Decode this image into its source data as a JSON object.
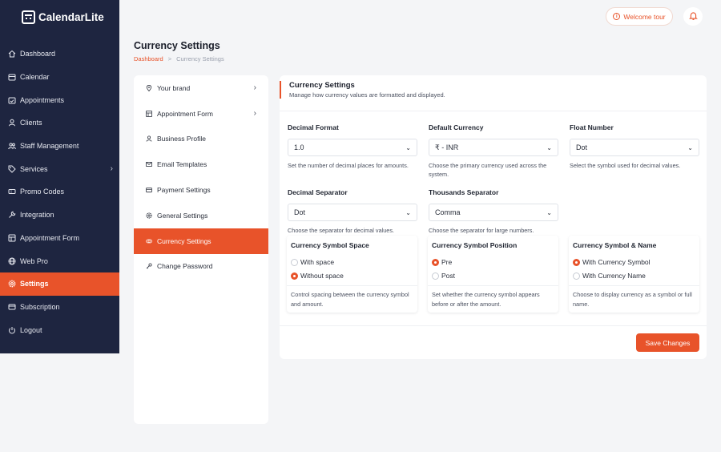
{
  "brand": {
    "name": "CalendarLite"
  },
  "topbar": {
    "welcome_label": "Welcome tour"
  },
  "sidebar": {
    "items": [
      {
        "label": "Dashboard",
        "icon": "home-icon"
      },
      {
        "label": "Calendar",
        "icon": "calendar-icon"
      },
      {
        "label": "Appointments",
        "icon": "calendar-check-icon"
      },
      {
        "label": "Clients",
        "icon": "user-icon"
      },
      {
        "label": "Staff Management",
        "icon": "users-icon"
      },
      {
        "label": "Services",
        "icon": "tag-icon",
        "has_submenu": true
      },
      {
        "label": "Promo Codes",
        "icon": "ticket-icon"
      },
      {
        "label": "Integration",
        "icon": "wrench-icon"
      },
      {
        "label": "Appointment Form",
        "icon": "form-icon"
      },
      {
        "label": "Web Pro",
        "icon": "globe-icon"
      },
      {
        "label": "Settings",
        "icon": "gear-icon",
        "active": true
      },
      {
        "label": "Subscription",
        "icon": "card-icon"
      },
      {
        "label": "Logout",
        "icon": "power-icon"
      }
    ]
  },
  "page": {
    "title": "Currency Settings",
    "breadcrumb": {
      "home": "Dashboard",
      "separator": ">",
      "current": "Currency Settings"
    }
  },
  "settings_menu": {
    "items": [
      {
        "label": "Your brand",
        "icon": "pin-icon",
        "has_submenu": true
      },
      {
        "label": "Appointment Form",
        "icon": "table-icon",
        "has_submenu": true
      },
      {
        "label": "Business Profile",
        "icon": "user-icon"
      },
      {
        "label": "Email Templates",
        "icon": "mail-icon"
      },
      {
        "label": "Payment Settings",
        "icon": "wallet-icon"
      },
      {
        "label": "General Settings",
        "icon": "gear-icon"
      },
      {
        "label": "Currency Settings",
        "icon": "coins-icon",
        "active": true
      },
      {
        "label": "Change Password",
        "icon": "key-icon"
      }
    ]
  },
  "card": {
    "title": "Currency Settings",
    "subtitle": "Manage how currency values are formatted and displayed.",
    "decimal_format": {
      "label": "Decimal Format",
      "value": "1.0",
      "help": "Set the number of decimal places for amounts."
    },
    "default_currency": {
      "label": "Default Currency",
      "value": "₹ - INR",
      "help": "Choose the primary currency used across the system."
    },
    "float_number": {
      "label": "Float Number",
      "value": "Dot",
      "help": "Select the symbol used for decimal values."
    },
    "decimal_separator": {
      "label": "Decimal Separator",
      "value": "Dot",
      "help": "Choose the separator for decimal values."
    },
    "thousands_separator": {
      "label": "Thousands Separator",
      "value": "Comma",
      "help": "Choose the separator for large numbers."
    },
    "symbol_space": {
      "title": "Currency Symbol Space",
      "options": [
        "With space",
        "Without space"
      ],
      "selected": "Without space",
      "help": "Control spacing between the currency symbol and amount."
    },
    "symbol_position": {
      "title": "Currency Symbol Position",
      "options": [
        "Pre",
        "Post"
      ],
      "selected": "Pre",
      "help": "Set whether the currency symbol appears before or after the amount."
    },
    "symbol_name": {
      "title": "Currency Symbol & Name",
      "options": [
        "With Currency Symbol",
        "With Currency Name"
      ],
      "selected": "With Currency Symbol",
      "help": "Choose to display currency as a symbol or full name."
    },
    "save_label": "Save Changes"
  },
  "colors": {
    "accent": "#e8532a",
    "sidebar_bg": "#1e2540"
  }
}
